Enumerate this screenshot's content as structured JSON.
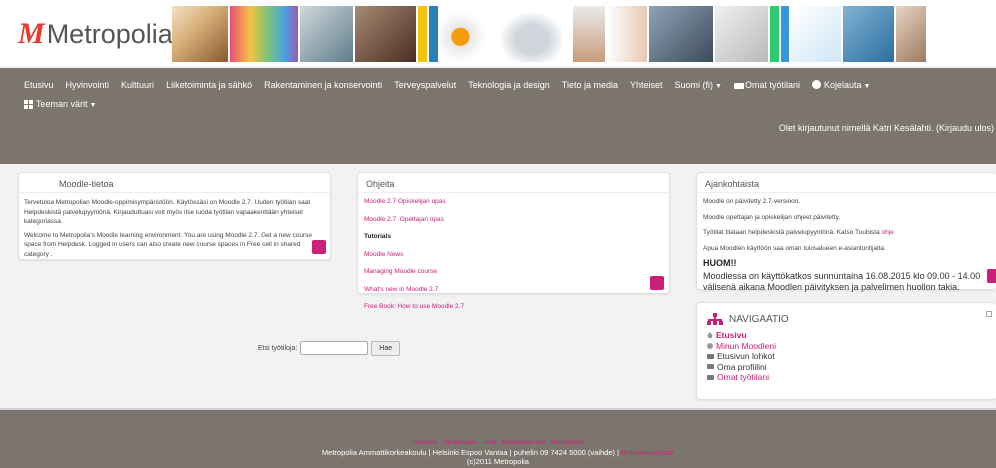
{
  "logo": {
    "mark": "M",
    "text": "Metropolia"
  },
  "nav": {
    "items": [
      {
        "label": "Etusivu"
      },
      {
        "label": "Hyvinvointi"
      },
      {
        "label": "Kulttuuri"
      },
      {
        "label": "Liiketoiminta ja sähkö"
      },
      {
        "label": "Rakentaminen ja konservointi"
      },
      {
        "label": "Terveyspalvelut"
      },
      {
        "label": "Teknologia ja design"
      },
      {
        "label": "Tieto ja media"
      },
      {
        "label": "Yhteiset"
      }
    ],
    "language": "Suomi (fi)",
    "my_workspaces": "Omat työtilani",
    "dashboard": "Kojelauta",
    "theme_colors": "Teeman värit",
    "login_info": "Olet kirjautunut nimellä Katri Kesälahti. (Kirjaudu ulos)"
  },
  "blocks": {
    "moodle_tietoa": {
      "title": "Moodle-tietoa",
      "p1": "Tervetuloa Metropolian Moodle-oppimisympäristöön. Käytössäsi on Moodle 2.7. Uuden työtilan saat Helpdeskistä palvelupyyntönä. Kirjauduttuasi voit myös itse luoda työtilan vapaakenttään yhteiset kategoriassa.",
      "p2": "Welcome to Metropolia's Moodle learning environment. You are using Moodle 2.7. Get a new course space from Helpdesk. Logged in users can also create new course spaces in Free cell in shared category ."
    },
    "ohjeita": {
      "title": "Ohjeita",
      "links": [
        "Moodle 2.7 Opiskelijan opas",
        "Moodle 2.7. Opettajan opas"
      ],
      "tutorials_heading": "Tutorials",
      "tutorial_links": [
        "Moodle News",
        "Managing Moodle course",
        "What's new in Moodle 2.7",
        "Free Book: How to use Moodle 2.7"
      ]
    },
    "ajankohtaista": {
      "title": "Ajankohtaista",
      "p1": "Moodle on päivitetty 2.7-versioon.",
      "p2": "Moodle opettajan ja opiskelijan ohjeet päivitetty.",
      "p3_text": "Työtilat tilataan helpdeskistä palvelupyyntönä. Katso Tuubista ",
      "p3_link": "ohje",
      "p4": "Apua Moodlen käyttöön saa oman tulosalueen e-asiantuntijalta.",
      "huom": "HUOM!!",
      "note": "Moodlessa on käyttökatkos sunnuntaina 16.08.2015 klo 09.00 - 14.00 välisenä aikana Moodlen päivityksen ja palvelimen huollon takia."
    },
    "navigation": {
      "title": "NAVIGAATIO",
      "items": [
        {
          "label": "Etusivu",
          "style": "active"
        },
        {
          "label": "Minun Moodleni",
          "style": "link"
        },
        {
          "label": "Etusivun lohkot",
          "style": "plain"
        },
        {
          "label": "Oma profiilini",
          "style": "plain"
        },
        {
          "label": "Omat työtilani",
          "style": "link"
        }
      ]
    }
  },
  "search": {
    "label": "Etsi työtiloja:",
    "placeholder": "",
    "button": "Hae"
  },
  "footer": {
    "links": [
      "Helpdesk",
      "Opinto-opas",
      "Tuubi",
      "Metropolian wiki",
      "Metropolia.fi"
    ],
    "address": "Metropolia Ammattikorkeakoulu | Helsinki Espoo Vantaa | puhelin 09 7424 5000 (vaihde) |",
    "privacy_link": "Rekisteriseloste",
    "copyright": "(c)2011 Metropolia"
  },
  "colors": {
    "accent": "#cc1f78",
    "nav_bg": "#7b756e",
    "page_bg": "#f2f2f2"
  }
}
